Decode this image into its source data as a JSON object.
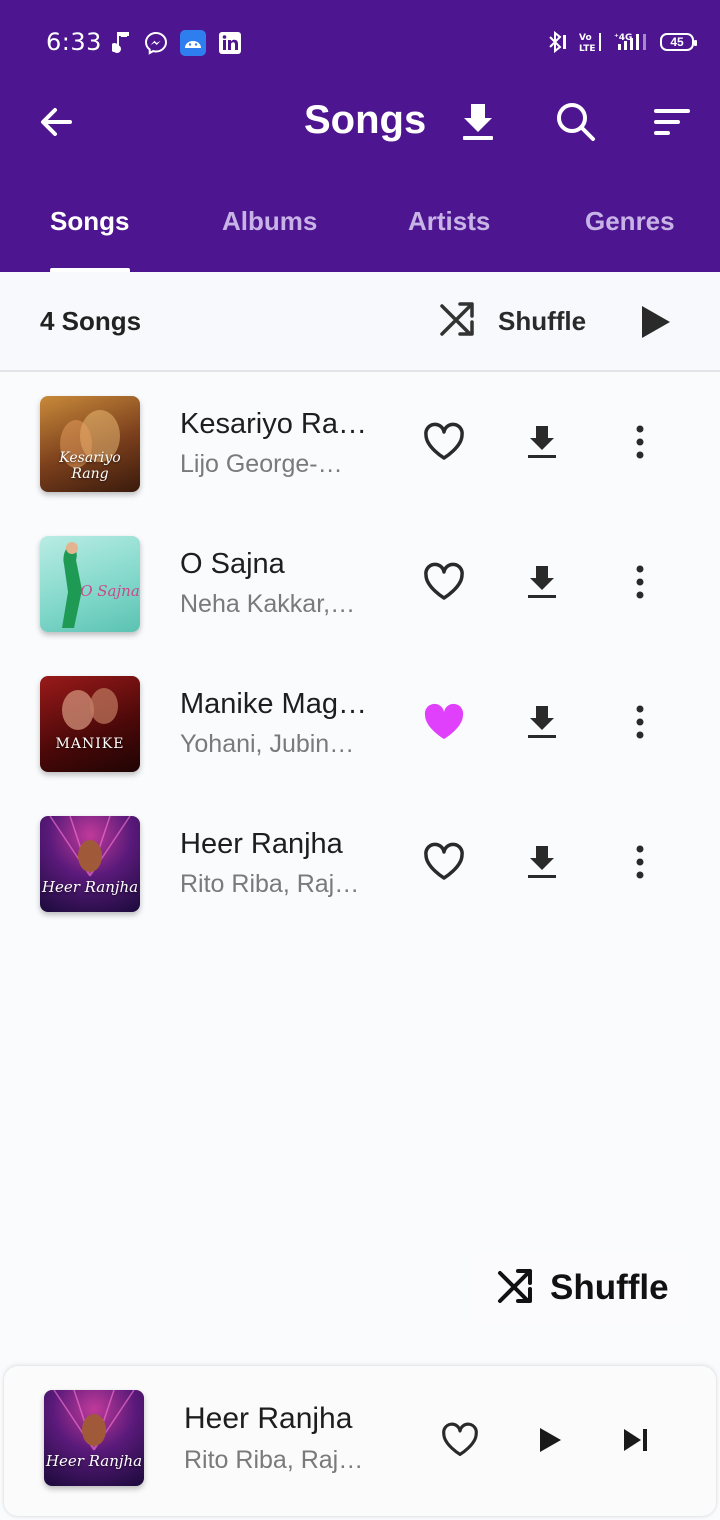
{
  "status_bar": {
    "time": "6:33",
    "battery": "45",
    "left_icons": [
      "music-note-icon",
      "messenger-icon",
      "android-icon",
      "linkedin-icon"
    ],
    "right_icons": [
      "bluetooth-icon",
      "volte-icon",
      "signal-4g-icon",
      "battery-icon"
    ]
  },
  "toolbar": {
    "title": "Songs",
    "icons": [
      "back-arrow-icon",
      "download-icon",
      "search-icon",
      "sort-icon"
    ]
  },
  "tabs": [
    {
      "label": "Songs",
      "active": true
    },
    {
      "label": "Albums",
      "active": false
    },
    {
      "label": "Artists",
      "active": false
    },
    {
      "label": "Genres",
      "active": false
    }
  ],
  "list_header": {
    "count_label": "4 Songs",
    "shuffle_label": "Shuffle"
  },
  "songs": [
    {
      "title": "Kesariyo Rang",
      "artist": "Lijo George-DJ Chetas",
      "favorite": false,
      "art_text": "Kesariyo Rang"
    },
    {
      "title": "O Sajna",
      "artist": "Neha Kakkar, Dhanashree Verma",
      "favorite": false,
      "art_text": "O Sajna"
    },
    {
      "title": "Manike Mage Hithe",
      "artist": "Yohani, Jubin Nautiyal",
      "favorite": true,
      "art_text": "MANIKE"
    },
    {
      "title": "Heer Ranjha",
      "artist": "Rito Riba, Rajat Nagpal",
      "favorite": false,
      "art_text": "Heer Ranjha"
    }
  ],
  "fab": {
    "label": "Shuffle"
  },
  "now_playing": {
    "title": "Heer Ranjha",
    "artist": "Rito Riba, Rajat Nagpal",
    "art_text": "Heer Ranjha",
    "favorite": false
  },
  "colors": {
    "header_bg": "#4d1590",
    "tab_inactive": "#c8b3e6",
    "favorite": "#e040fb"
  }
}
